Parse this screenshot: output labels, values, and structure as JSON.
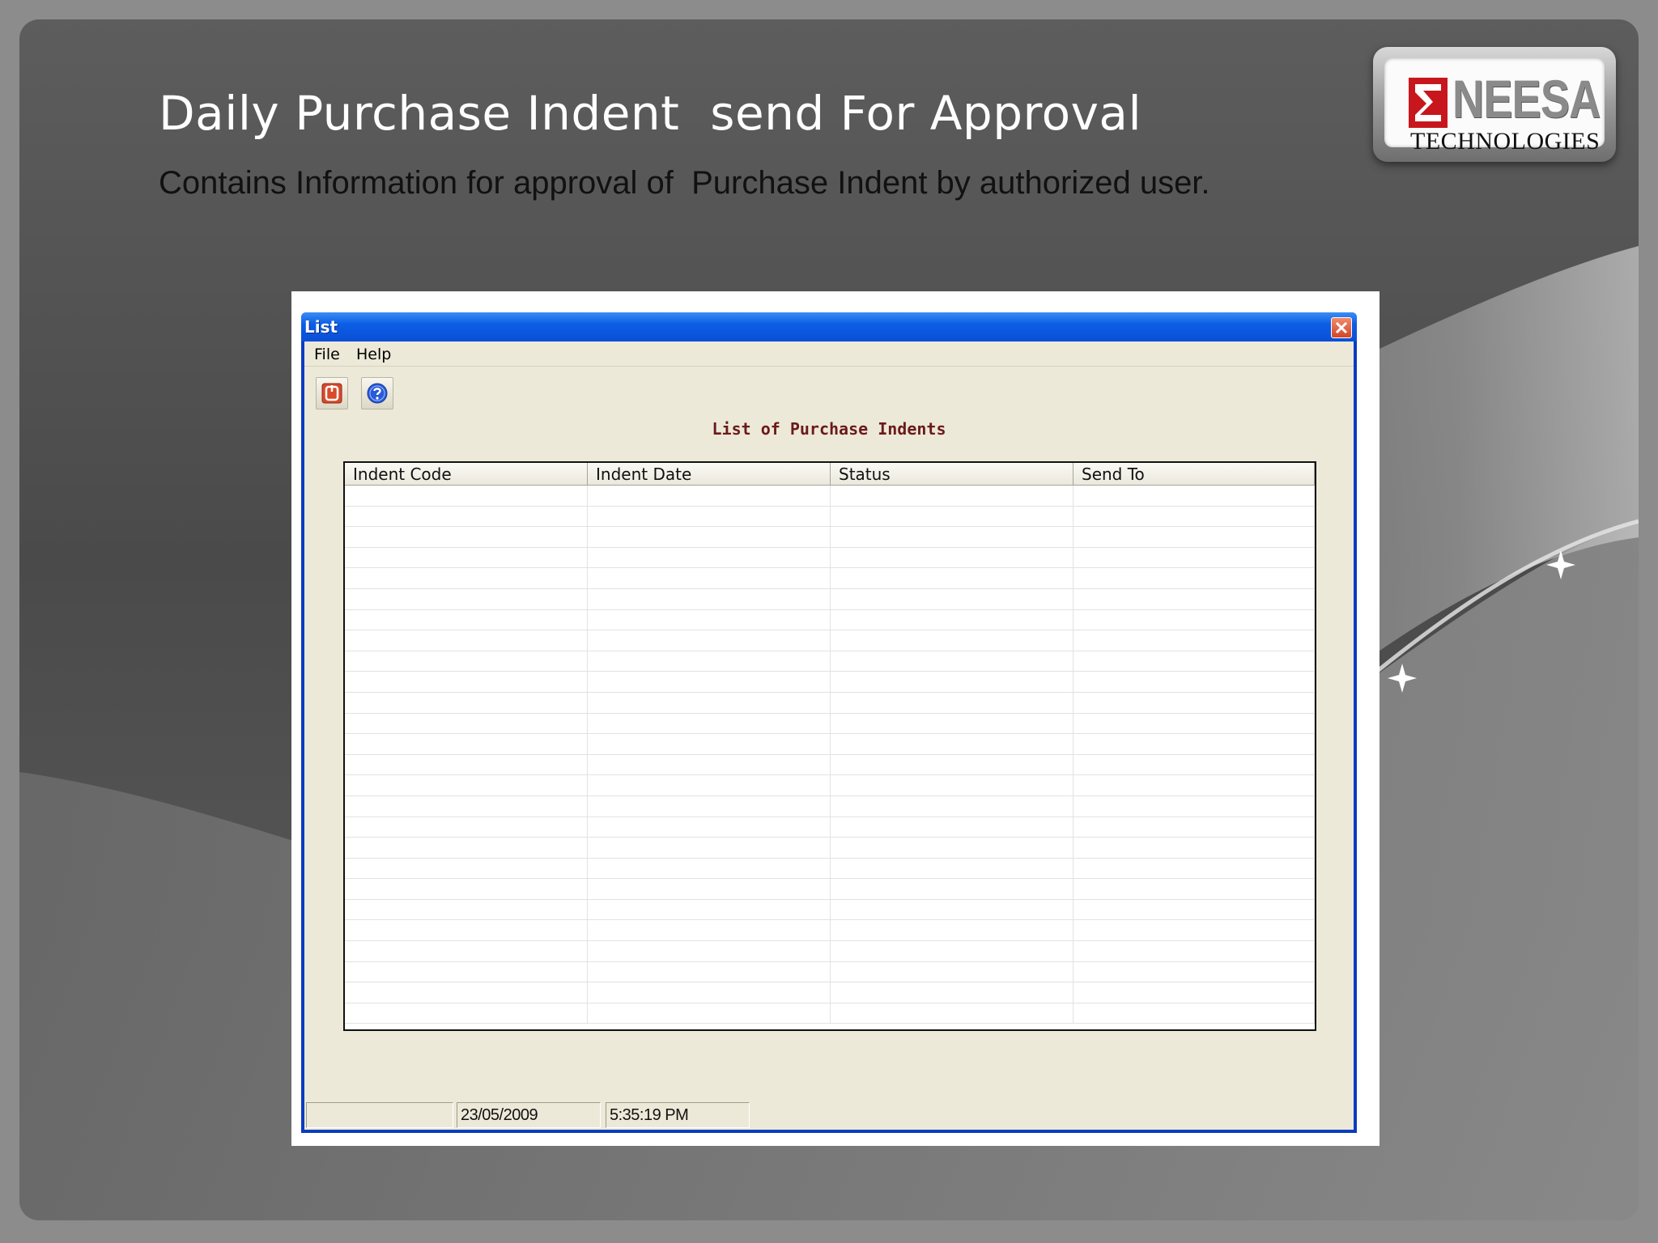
{
  "slide": {
    "title": "Daily Purchase Indent  send For Approval",
    "subtitle": "Contains Information for approval of  Purchase Indent by authorized user."
  },
  "logo": {
    "name": "NEESA",
    "tagline": "TECHNOLOGIES"
  },
  "window": {
    "title": "List",
    "menu": [
      "File",
      "Help"
    ],
    "toolbar": [
      {
        "icon": "exit-icon"
      },
      {
        "icon": "help-icon"
      }
    ],
    "heading": "List of Purchase Indents",
    "table": {
      "columns": [
        "Indent Code",
        "Indent Date",
        "Status",
        "Send To"
      ],
      "rows": []
    },
    "status": {
      "panel1": "",
      "date": "23/05/2009",
      "time": "5:35:19 PM"
    }
  },
  "colors": {
    "titlebar": "#0c5ee5",
    "client": "#ece9d8",
    "heading": "#6b1a1a",
    "logo_red": "#c8161d"
  }
}
